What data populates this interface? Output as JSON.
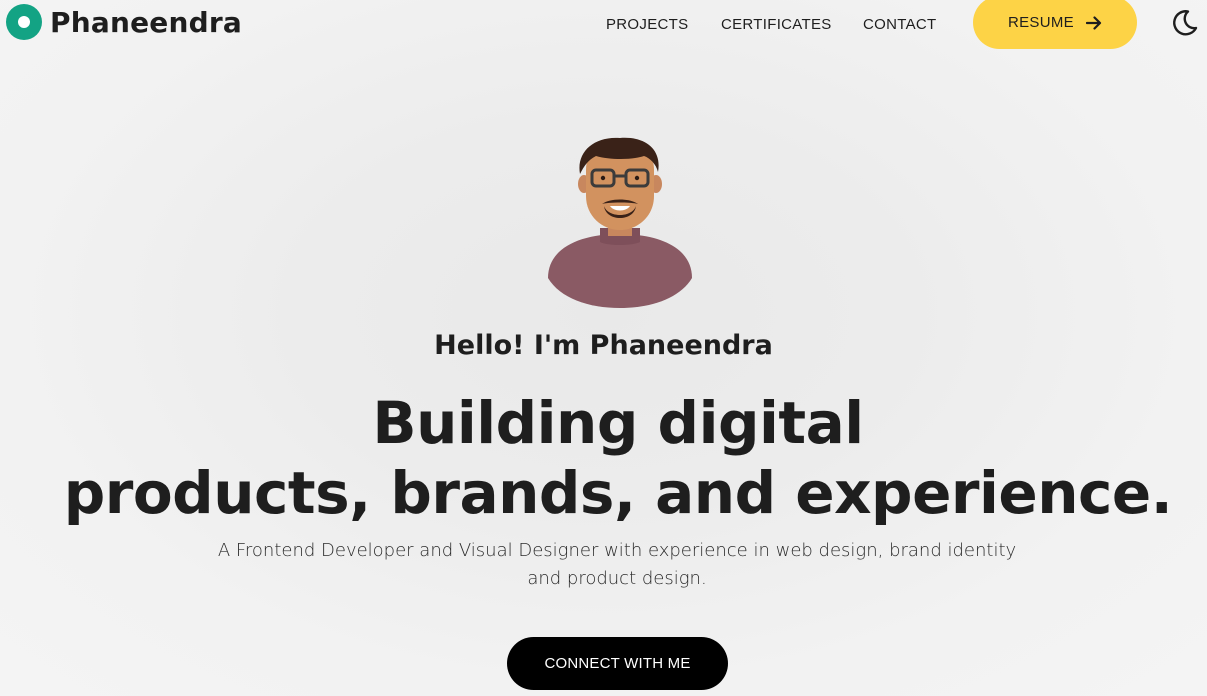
{
  "header": {
    "logo_text": "Phaneendra",
    "logo_icon": "circle-logo-icon",
    "nav": [
      {
        "label": "PROJECTS"
      },
      {
        "label": "CERTIFICATES"
      },
      {
        "label": "CONTACT"
      }
    ],
    "resume_label": "RESUME",
    "resume_icon": "arrow-right-icon",
    "theme_icon": "moon-icon"
  },
  "hero": {
    "avatar_icon": "avatar-illustration",
    "greeting": "Hello! I'm Phaneendra",
    "headline_line1": "Building digital",
    "headline_line2": "products, brands, and experience.",
    "subtitle": "A Frontend Developer and Visual Designer with experience in web design, brand identity and product design.",
    "cta_label": "CONNECT WITH ME"
  },
  "colors": {
    "brand": "#13a384",
    "accent": "#fdd346",
    "cta": "#000000",
    "text": "#1e1e1e"
  }
}
